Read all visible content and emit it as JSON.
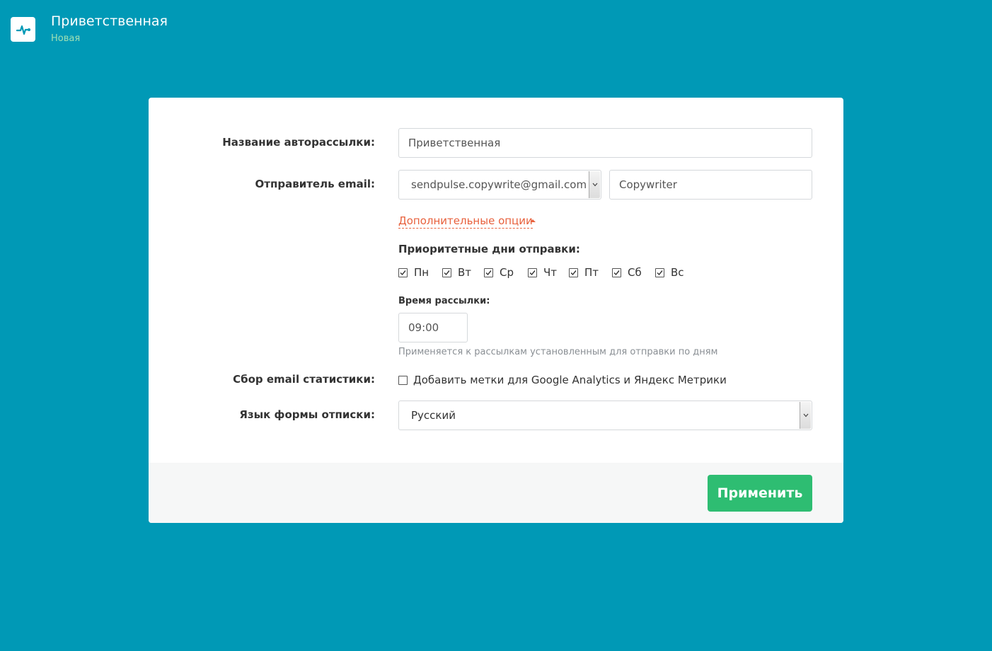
{
  "header": {
    "title": "Приветственная",
    "subtitle": "Новая"
  },
  "form": {
    "name_label": "Название авторассылки:",
    "name_value": "Приветственная",
    "sender_label": "Отправитель email:",
    "sender_email": "sendpulse.copywrite@gmail.com",
    "sender_name": "Copywriter",
    "advanced_link": "Дополнительные опции",
    "priority_days_label": "Приоритетные дни отправки:",
    "days": [
      {
        "label": "Пн",
        "checked": true
      },
      {
        "label": "Вт",
        "checked": true
      },
      {
        "label": "Ср",
        "checked": true
      },
      {
        "label": "Чт",
        "checked": true
      },
      {
        "label": "Пт",
        "checked": true
      },
      {
        "label": "Сб",
        "checked": true
      },
      {
        "label": "Вс",
        "checked": true
      }
    ],
    "time_label": "Время рассылки:",
    "time_value": "09:00",
    "time_hint": "Применяется к рассылкам установленным для отправки по дням",
    "stats_label": "Сбор email статистики:",
    "stats_checkbox_label": "Добавить метки для Google Analytics и Яндекс Метрики",
    "stats_checked": false,
    "lang_label": "Язык формы отписки:",
    "lang_value": "Русский"
  },
  "footer": {
    "apply_button": "Применить"
  },
  "colors": {
    "background": "#0099b6",
    "accent_link": "#e8613d",
    "button": "#2ebd72"
  }
}
